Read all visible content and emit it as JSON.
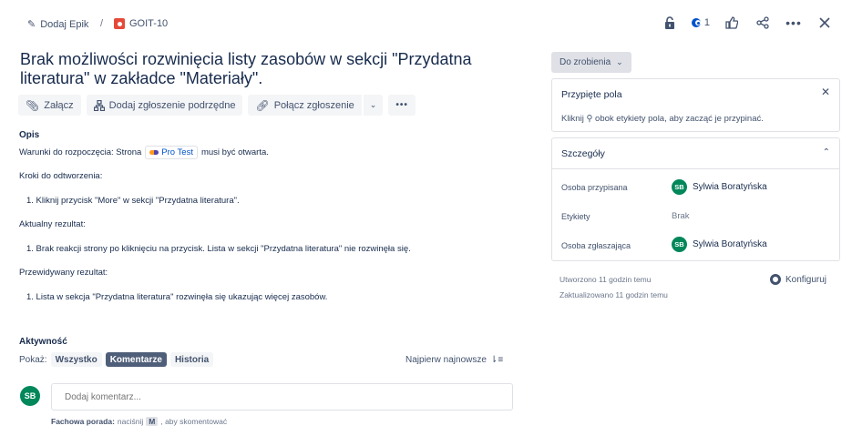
{
  "breadcrumb": {
    "epic_label": "Dodaj Epik",
    "separator": "/",
    "issue_key": "GOIT-10"
  },
  "top_actions": {
    "watch_count": "1"
  },
  "issue": {
    "title": "Brak możliwości rozwinięcia listy zasobów w sekcji \"Przydatna literatura\" w zakładce \"Materiały\"."
  },
  "toolbar": {
    "attach": "Załącz",
    "add_subtask": "Dodaj zgłoszenie podrzędne",
    "link_issue": "Połącz zgłoszenie"
  },
  "description": {
    "heading": "Opis",
    "precondition": "Warunki do rozpoczęcia: Strona",
    "precondition_link": "Pro Test",
    "precondition_end": "musi być otwarta.",
    "steps_heading": "Kroki do odtworzenia:",
    "step_1": "1. Kliknij przycisk \"More\" w sekcji \"Przydatna literatura\".",
    "actual_heading": "Aktualny rezultat:",
    "actual_1": "1. Brak reakcji strony po kliknięciu na przycisk. Lista w sekcji \"Przydatna literatura\" nie rozwinęła się.",
    "expected_heading": "Przewidywany rezultat:",
    "expected_1": "1. Lista w sekcja \"Przydatna literatura\" rozwinęła się ukazując więcej zasobów."
  },
  "activity": {
    "heading": "Aktywność",
    "show_label": "Pokaż:",
    "filters": [
      "Wszystko",
      "Komentarze",
      "Historia"
    ],
    "active_filter": "Komentarze",
    "sort_label": "Najpierw najnowsze",
    "comment_placeholder": "Dodaj komentarz...",
    "tip_bold": "Fachowa porada:",
    "tip_text": "naciśnij",
    "tip_key": "M",
    "tip_end": ", aby skomentować",
    "user_initials": "SB"
  },
  "status": {
    "label": "Do zrobienia"
  },
  "pinned": {
    "heading": "Przypięte pola",
    "hint": "Kliknij ⚲ obok etykiety pola, aby zacząć je przypinać."
  },
  "details": {
    "heading": "Szczegóły",
    "assignee_label": "Osoba przypisana",
    "assignee_initials": "SB",
    "assignee_name": "Sylwia Boratyńska",
    "labels_label": "Etykiety",
    "labels_value": "Brak",
    "reporter_label": "Osoba zgłaszająca",
    "reporter_initials": "SB",
    "reporter_name": "Sylwia Boratyńska"
  },
  "meta": {
    "created": "Utworzono 11 godzin temu",
    "updated": "Zaktualizowano 11 godzin temu",
    "configure": "Konfiguruj"
  },
  "colors": {
    "avatar": "#00875a",
    "issue_type": "#e5493a",
    "link": "#0052cc"
  }
}
